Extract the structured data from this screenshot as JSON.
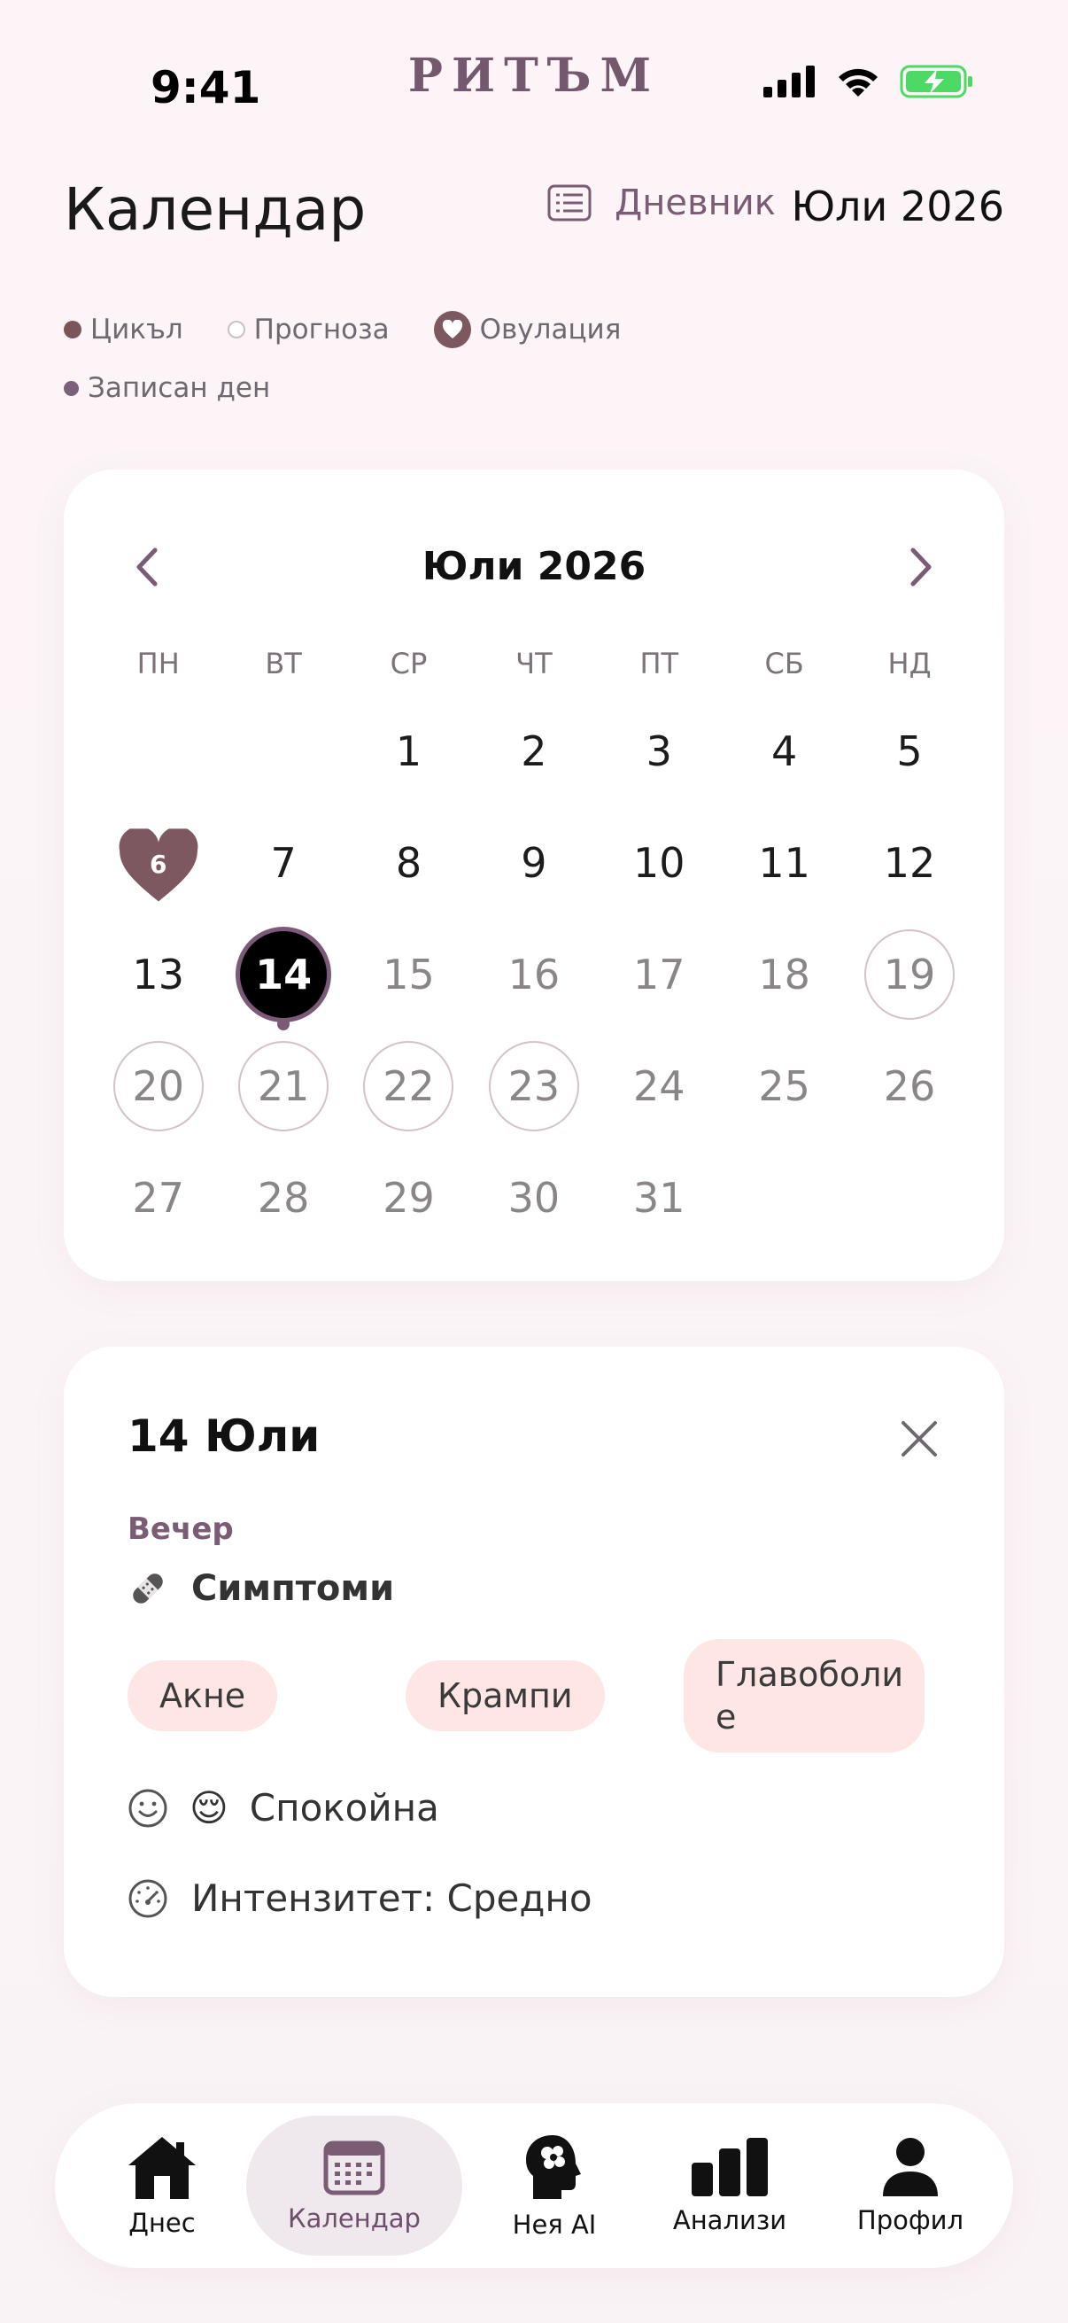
{
  "status_bar": {
    "time": "9:41",
    "brand": "РИТЪМ"
  },
  "header": {
    "title": "Календар",
    "journal_label": "Дневник",
    "month": "Юли 2026"
  },
  "legend": {
    "cycle": "Цикъл",
    "forecast": "Прогноза",
    "ovulation": "Овулация",
    "logged": "Записан ден"
  },
  "calendar": {
    "title": "Юли 2026",
    "weekdays": [
      "ПН",
      "ВТ",
      "СР",
      "ЧТ",
      "ПТ",
      "СБ",
      "НД"
    ],
    "days": {
      "d1": "1",
      "d2": "2",
      "d3": "3",
      "d4": "4",
      "d5": "5",
      "d6": "6",
      "d7": "7",
      "d8": "8",
      "d9": "9",
      "d10": "10",
      "d11": "11",
      "d12": "12",
      "d13": "13",
      "d14": "14",
      "d15": "15",
      "d16": "16",
      "d17": "17",
      "d18": "18",
      "d19": "19",
      "d20": "20",
      "d21": "21",
      "d22": "22",
      "d23": "23",
      "d24": "24",
      "d25": "25",
      "d26": "26",
      "d27": "27",
      "d28": "28",
      "d29": "29",
      "d30": "30",
      "d31": "31"
    }
  },
  "detail": {
    "date": "14 Юли",
    "period": "Вечер",
    "symptoms_title": "Симптоми",
    "symptoms": [
      "Акне",
      "Крампи",
      "Главоболи е"
    ],
    "mood_emoji": "😌",
    "mood": "Спокойна",
    "intensity": "Интензитет: Средно"
  },
  "tabs": {
    "today": "Днес",
    "calendar": "Календар",
    "ai": "Нея AI",
    "analytics": "Анализи",
    "profile": "Профил"
  },
  "colors": {
    "accent": "#7a5c74",
    "cycle": "#7a5559",
    "chip_bg": "#fde6e4",
    "battery": "#4cd964"
  }
}
